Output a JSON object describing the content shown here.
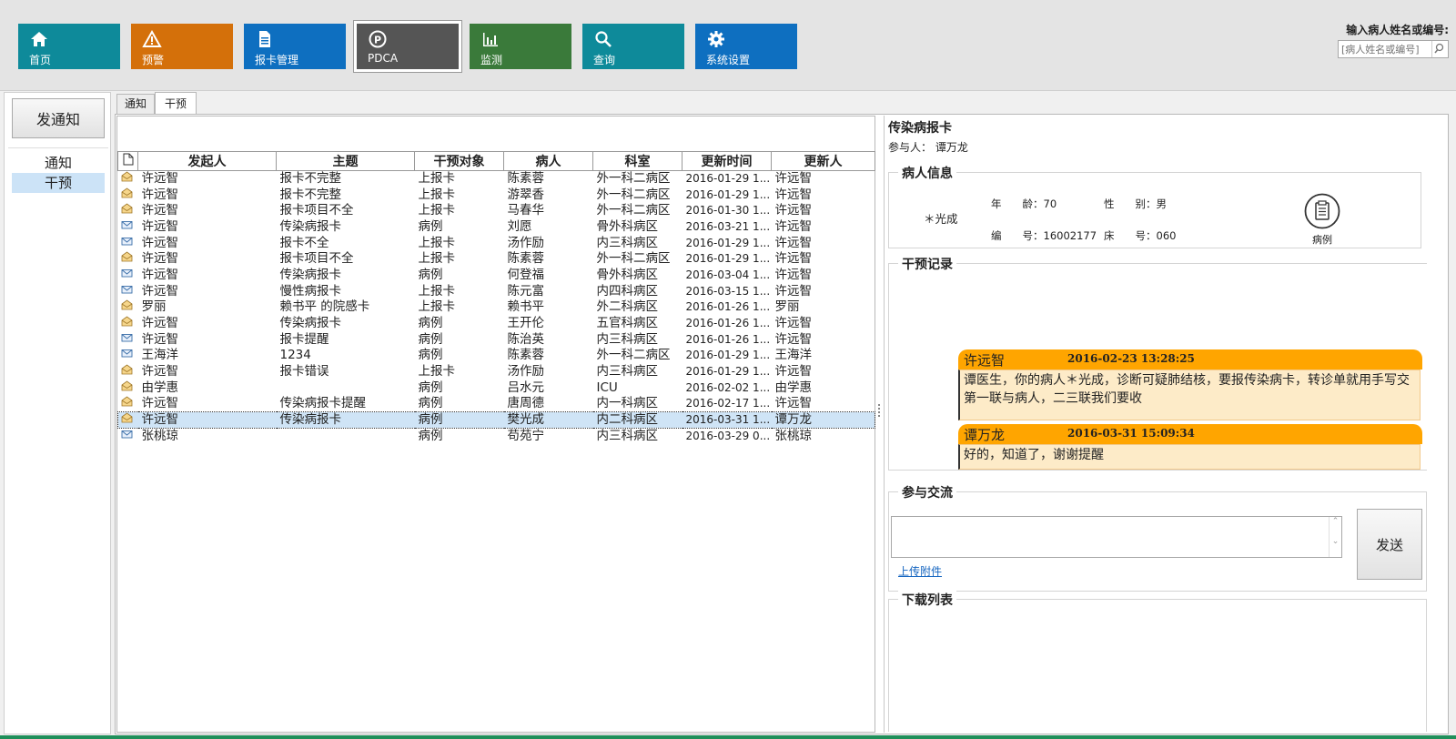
{
  "toolbar": {
    "tiles": [
      {
        "label": "首页",
        "icon": "home-icon",
        "color": "#0e8a9a"
      },
      {
        "label": "预警",
        "icon": "warning-icon",
        "color": "#d4700a"
      },
      {
        "label": "报卡管理",
        "icon": "document-icon",
        "color": "#0e6fc0"
      },
      {
        "label": "PDCA",
        "icon": "pdca-icon",
        "color": "#555555"
      },
      {
        "label": "监测",
        "icon": "bar-chart-icon",
        "color": "#3a7a3a"
      },
      {
        "label": "查询",
        "icon": "search-icon",
        "color": "#0e8a9a"
      },
      {
        "label": "系统设置",
        "icon": "gear-icon",
        "color": "#0e6fc0"
      }
    ],
    "search_title": "输入病人姓名或编号:",
    "search_placeholder": "[病人姓名或编号]"
  },
  "sidebar": {
    "send_button": "发通知",
    "items": [
      {
        "label": "通知",
        "selected": false
      },
      {
        "label": "干预",
        "selected": true
      }
    ]
  },
  "tabs": [
    "通知",
    "干预"
  ],
  "grid": {
    "columns": [
      "发起人",
      "主题",
      "干预对象",
      "病人",
      "科室",
      "更新时间",
      "更新人"
    ],
    "rows": [
      {
        "icon": "envelope-open-icon",
        "sender": "许远智",
        "subject": "报卡不完整",
        "target": "上报卡",
        "patient": "陈素蓉",
        "dept": "外一科二病区",
        "time": "2016-01-29 1...",
        "updater": "许远智"
      },
      {
        "icon": "envelope-open-icon",
        "sender": "许远智",
        "subject": "报卡不完整",
        "target": "上报卡",
        "patient": "游翠香",
        "dept": "外一科二病区",
        "time": "2016-01-29 1...",
        "updater": "许远智"
      },
      {
        "icon": "envelope-open-icon",
        "sender": "许远智",
        "subject": "报卡项目不全",
        "target": "上报卡",
        "patient": "马春华",
        "dept": "外一科二病区",
        "time": "2016-01-30 1...",
        "updater": "许远智"
      },
      {
        "icon": "envelope-icon",
        "sender": "许远智",
        "subject": "传染病报卡",
        "target": "病例",
        "patient": "刘愿",
        "dept": "骨外科病区",
        "time": "2016-03-21 1...",
        "updater": "许远智"
      },
      {
        "icon": "envelope-icon",
        "sender": "许远智",
        "subject": "报卡不全",
        "target": "上报卡",
        "patient": "汤作励",
        "dept": "内三科病区",
        "time": "2016-01-29 1...",
        "updater": "许远智"
      },
      {
        "icon": "envelope-open-icon",
        "sender": "许远智",
        "subject": "报卡项目不全",
        "target": "上报卡",
        "patient": "陈素蓉",
        "dept": "外一科二病区",
        "time": "2016-01-29 1...",
        "updater": "许远智"
      },
      {
        "icon": "envelope-icon",
        "sender": "许远智",
        "subject": "传染病报卡",
        "target": "病例",
        "patient": "何登福",
        "dept": "骨外科病区",
        "time": "2016-03-04 1...",
        "updater": "许远智"
      },
      {
        "icon": "envelope-icon",
        "sender": "许远智",
        "subject": "慢性病报卡",
        "target": "上报卡",
        "patient": "陈元富",
        "dept": "内四科病区",
        "time": "2016-03-15 1...",
        "updater": "许远智"
      },
      {
        "icon": "envelope-open-icon",
        "sender": "罗丽",
        "subject": "赖书平  的院感卡",
        "target": "上报卡",
        "patient": "赖书平",
        "dept": "外二科病区",
        "time": "2016-01-26 1...",
        "updater": "罗丽"
      },
      {
        "icon": "envelope-open-icon",
        "sender": "许远智",
        "subject": "传染病报卡",
        "target": "病例",
        "patient": "王开伦",
        "dept": "五官科病区",
        "time": "2016-01-26 1...",
        "updater": "许远智"
      },
      {
        "icon": "envelope-icon",
        "sender": "许远智",
        "subject": "报卡提醒",
        "target": "病例",
        "patient": "陈治英",
        "dept": "内三科病区",
        "time": "2016-01-26 1...",
        "updater": "许远智"
      },
      {
        "icon": "envelope-icon",
        "sender": "王海洋",
        "subject": "1234",
        "target": "病例",
        "patient": "陈素蓉",
        "dept": "外一科二病区",
        "time": "2016-01-29 1...",
        "updater": "王海洋"
      },
      {
        "icon": "envelope-open-icon",
        "sender": "许远智",
        "subject": "报卡错误",
        "target": "上报卡",
        "patient": "汤作励",
        "dept": "内三科病区",
        "time": "2016-01-29 1...",
        "updater": "许远智"
      },
      {
        "icon": "envelope-open-icon",
        "sender": "由学惠",
        "subject": "",
        "target": "病例",
        "patient": "吕水元",
        "dept": "ICU",
        "time": "2016-02-02 1...",
        "updater": "由学惠"
      },
      {
        "icon": "envelope-open-icon",
        "sender": "许远智",
        "subject": "传染病报卡提醒",
        "target": "病例",
        "patient": "唐周德",
        "dept": "内一科病区",
        "time": "2016-02-17 1...",
        "updater": "许远智"
      },
      {
        "icon": "envelope-open-icon",
        "sender": "许远智",
        "subject": "传染病报卡",
        "target": "病例",
        "patient": "樊光成",
        "dept": "内二科病区",
        "time": "2016-03-31 1...",
        "updater": "谭万龙",
        "selected": true
      },
      {
        "icon": "envelope-icon",
        "sender": "张桃琼",
        "subject": "",
        "target": "病例",
        "patient": "苟苑宁",
        "dept": "内三科病区",
        "time": "2016-03-29 0...",
        "updater": "张桃琼"
      }
    ]
  },
  "detail": {
    "title": "传染病报卡",
    "participants": "参与人：  谭万龙",
    "patient_group": "病人信息",
    "patient": {
      "name": "＊光成",
      "age_label": "年　　龄：70",
      "gender_label": "性　　别：男",
      "id_label": "编　　号：16002177",
      "bed_label": "床　　号：060",
      "record_label": "病例"
    },
    "intervention_group": "干预记录",
    "messages": [
      {
        "author": "许远智",
        "time": "2016-02-23 13:28:25",
        "text": "谭医生，你的病人＊光成，诊断可疑肺结核，要报传染病卡，转诊单就用手写交第一联与病人，二三联我们要收"
      },
      {
        "author": "谭万龙",
        "time": "2016-03-31 15:09:34",
        "text": "好的，知道了，谢谢提醒"
      }
    ],
    "discussion_group": "参与交流",
    "upload_label": "上传附件",
    "send_label": "发送",
    "download_group": "下载列表"
  }
}
